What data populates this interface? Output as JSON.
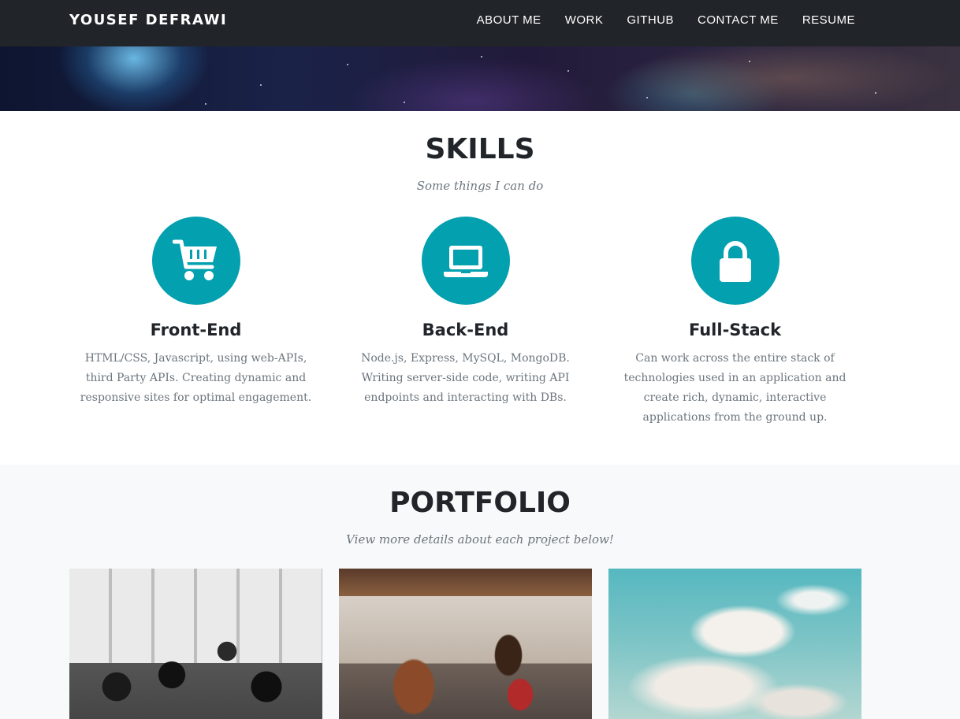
{
  "navbar": {
    "brand": "YOUSEF DEFRAWI",
    "links": [
      {
        "label": "ABOUT ME"
      },
      {
        "label": "WORK"
      },
      {
        "label": "GITHUB"
      },
      {
        "label": "CONTACT ME"
      },
      {
        "label": "RESUME"
      }
    ]
  },
  "skills": {
    "title": "SKILLS",
    "subtitle": "Some things I can do",
    "items": [
      {
        "icon": "shopping-cart-icon",
        "heading": "Front-End",
        "text": "HTML/CSS, Javascript, using web-APIs, third Party APIs. Creating dynamic and responsive sites for optimal engagement."
      },
      {
        "icon": "laptop-icon",
        "heading": "Back-End",
        "text": "Node.js, Express, MySQL, MongoDB. Writing server-side code, writing API endpoints and interacting with DBs."
      },
      {
        "icon": "lock-icon",
        "heading": "Full-Stack",
        "text": "Can work across the entire stack of technologies used in an application and create rich, dynamic, interactive applications from the ground up."
      }
    ]
  },
  "portfolio": {
    "title": "PORTFOLIO",
    "subtitle": "View more details about each project below!"
  },
  "colors": {
    "navbar_bg": "#212529",
    "accent": "#03a0b0",
    "muted_text": "#6c757d",
    "portfolio_bg": "#f8f9fa"
  }
}
